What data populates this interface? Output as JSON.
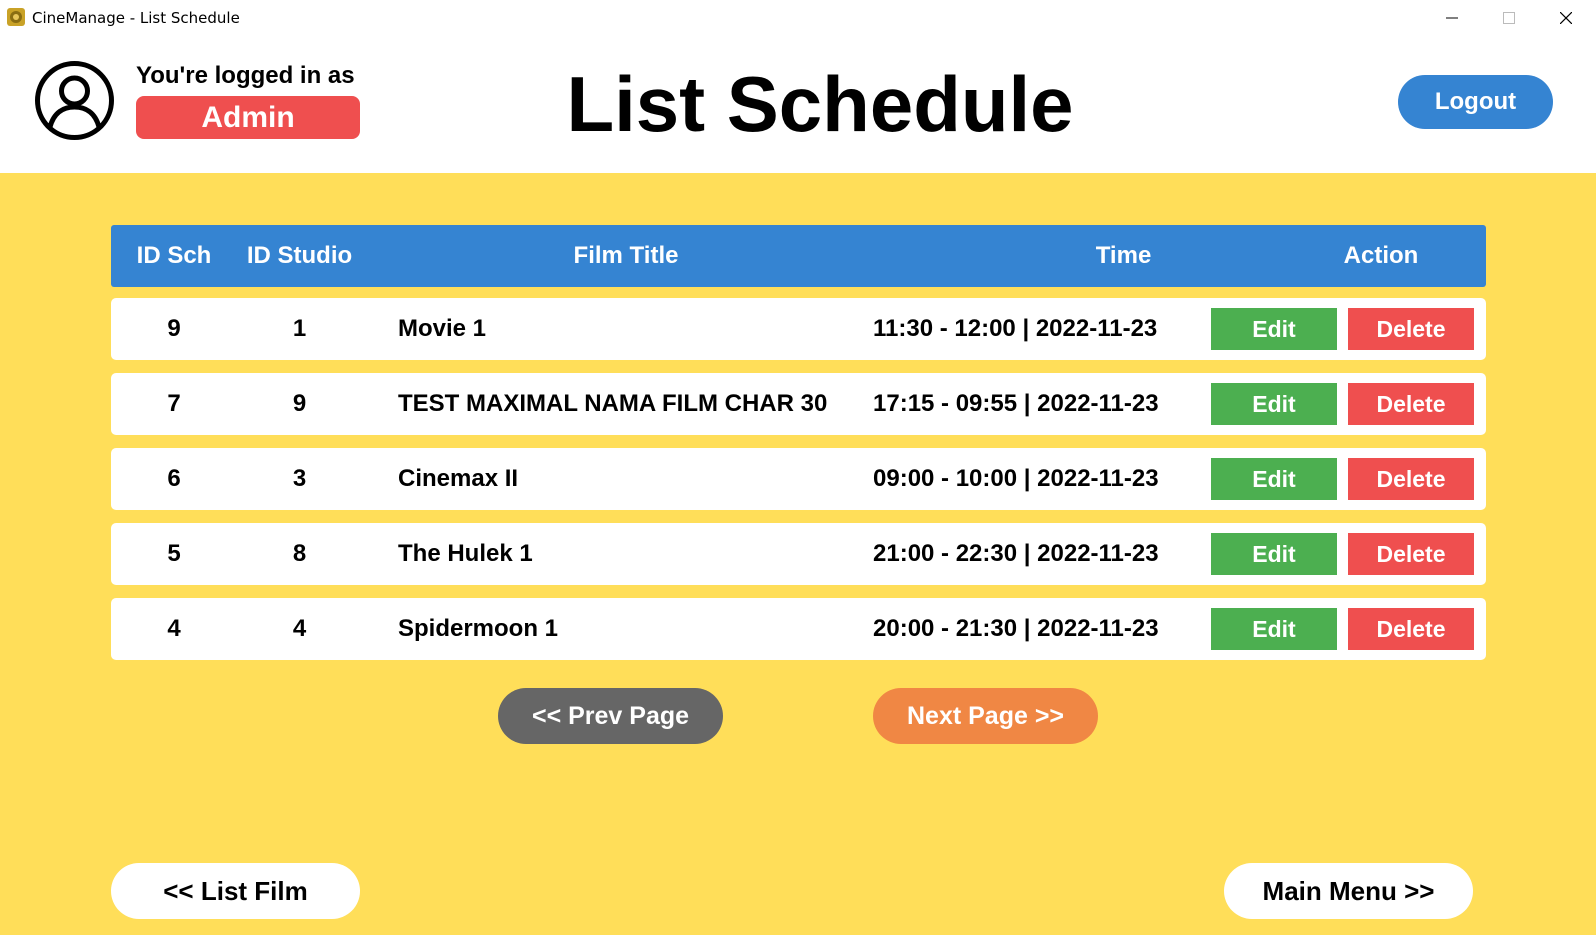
{
  "window": {
    "title": "CineManage - List Schedule"
  },
  "header": {
    "logged_label": "You're logged in as",
    "role": "Admin",
    "page_title": "List Schedule",
    "logout_label": "Logout"
  },
  "table": {
    "columns": [
      "ID Sch",
      "ID Studio",
      "Film Title",
      "Time",
      "Action"
    ],
    "rows": [
      {
        "id_sch": "9",
        "id_studio": "1",
        "film_title": "Movie 1",
        "time": "11:30 - 12:00 | 2022-11-23",
        "edit": "Edit",
        "delete": "Delete"
      },
      {
        "id_sch": "7",
        "id_studio": "9",
        "film_title": "TEST MAXIMAL NAMA FILM CHAR 30",
        "time": "17:15 - 09:55 | 2022-11-23",
        "edit": "Edit",
        "delete": "Delete"
      },
      {
        "id_sch": "6",
        "id_studio": "3",
        "film_title": "Cinemax II",
        "time": "09:00 - 10:00 | 2022-11-23",
        "edit": "Edit",
        "delete": "Delete"
      },
      {
        "id_sch": "5",
        "id_studio": "8",
        "film_title": "The Hulek 1",
        "time": "21:00 - 22:30 | 2022-11-23",
        "edit": "Edit",
        "delete": "Delete"
      },
      {
        "id_sch": "4",
        "id_studio": "4",
        "film_title": "Spidermoon 1",
        "time": "20:00 - 21:30 | 2022-11-23",
        "edit": "Edit",
        "delete": "Delete"
      }
    ]
  },
  "pagination": {
    "prev_label": "<< Prev Page",
    "next_label": "Next Page >>"
  },
  "footer_nav": {
    "list_film_label": "<< List Film",
    "main_menu_label": "Main Menu >>"
  },
  "colors": {
    "background": "#ffde59",
    "header_blue": "#3584d2",
    "edit_green": "#4caf50",
    "delete_red": "#ef4f4f",
    "prev_gray": "#666666",
    "next_orange": "#f08744"
  },
  "icons": {
    "app": "cinemanage-app-icon",
    "avatar": "user-avatar-icon",
    "minimize": "minimize-icon",
    "maximize": "maximize-icon",
    "close": "close-icon"
  }
}
